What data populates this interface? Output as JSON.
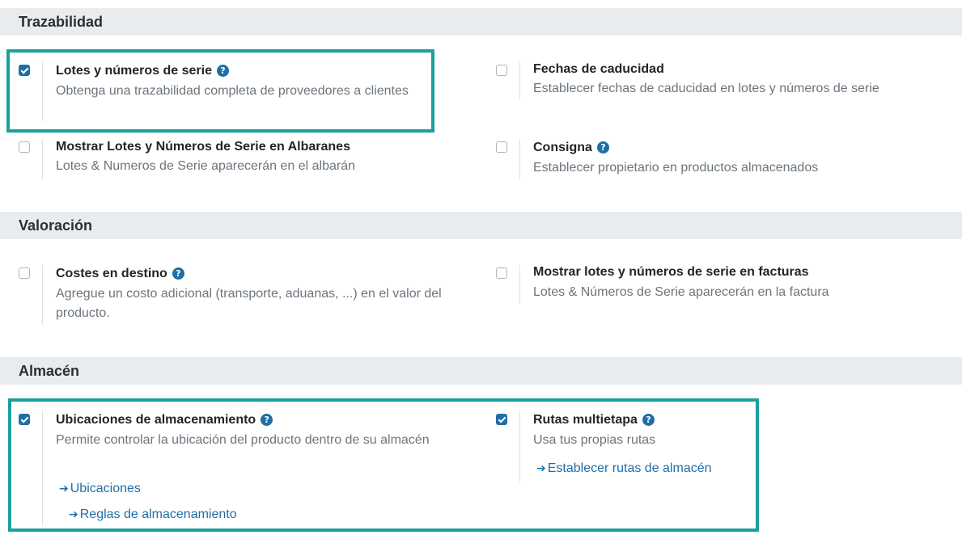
{
  "sections": {
    "traceability": "Trazabilidad",
    "valuation": "Valoración",
    "warehouse": "Almacén"
  },
  "settings": {
    "lots_serial": {
      "title": "Lotes y números de serie",
      "desc": "Obtenga una trazabilidad completa de proveedores a clientes",
      "checked": true
    },
    "expiration_dates": {
      "title": "Fechas de caducidad",
      "desc": "Establecer fechas de caducidad en lotes y números de serie",
      "checked": false
    },
    "show_lots_delivery": {
      "title": "Mostrar Lotes y Números de Serie en Albaranes",
      "desc": "Lotes & Numeros de Serie aparecerán en el albarán",
      "checked": false
    },
    "consignment": {
      "title": "Consigna",
      "desc": "Establecer propietario en productos almacenados",
      "checked": false
    },
    "landed_costs": {
      "title": "Costes en destino",
      "desc": "Agregue un costo adicional (transporte, aduanas, ...) en el valor del producto.",
      "checked": false
    },
    "lots_invoices": {
      "title": "Mostrar lotes y números de serie en facturas",
      "desc": "Lotes & Números de Serie aparecerán en la factura",
      "checked": false
    },
    "storage_locations": {
      "title": "Ubicaciones de almacenamiento",
      "desc": "Permite controlar la ubicación del producto dentro de su almacén",
      "checked": true,
      "link1": "Ubicaciones",
      "link2": "Reglas de almacenamiento"
    },
    "multistep_routes": {
      "title": "Rutas multietapa",
      "desc": "Usa tus propias rutas",
      "checked": true,
      "link1": "Establecer rutas de almacén"
    }
  },
  "icons": {
    "help": "question-circle-icon",
    "arrow": "arrow-right-icon"
  },
  "colors": {
    "accent": "#1f6ea6",
    "highlight": "#17a2a0",
    "section_bg": "#e9ecef"
  }
}
